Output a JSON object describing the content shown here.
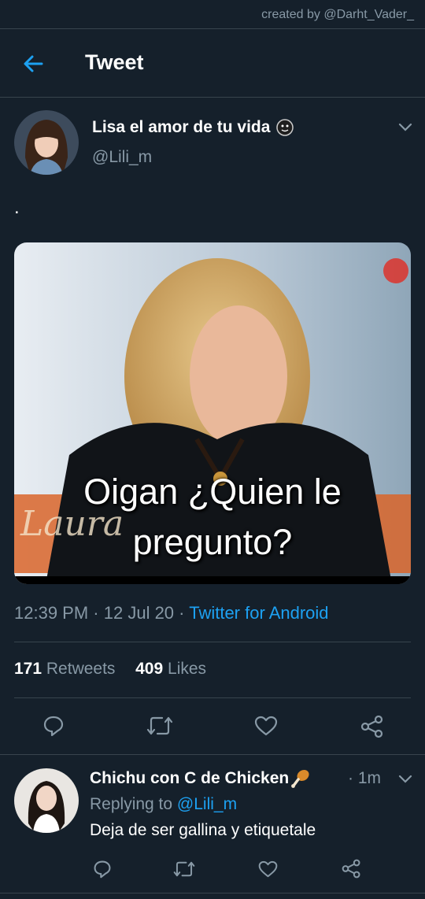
{
  "watermark": "created by @Darht_Vader_",
  "header": {
    "title": "Tweet"
  },
  "tweet": {
    "author_name": "Lisa el amor de tu vida",
    "author_handle": "@Lili_m",
    "text": ".",
    "media_caption_line1": "Oigan ¿Quien le",
    "media_caption_line2": "pregunto?",
    "media_logo_text": "Laura",
    "time": "12:39 PM",
    "date": "12 Jul 20",
    "source": "Twitter for Android",
    "retweets_count": "171",
    "retweets_label": "Retweets",
    "likes_count": "409",
    "likes_label": "Likes"
  },
  "actions": [
    "reply-icon",
    "retweet-icon",
    "like-icon",
    "share-icon"
  ],
  "reply": {
    "author_name": "Chichu con C de Chicken",
    "time": "1m",
    "replying_to_label": "Replying to",
    "replying_to_handle": "@Lili_m",
    "text": "Deja de ser gallina y etiquetale"
  },
  "colors": {
    "background": "#15202b",
    "accent": "#1da1f2",
    "secondary_text": "#8899a6",
    "divider": "#38444d"
  }
}
